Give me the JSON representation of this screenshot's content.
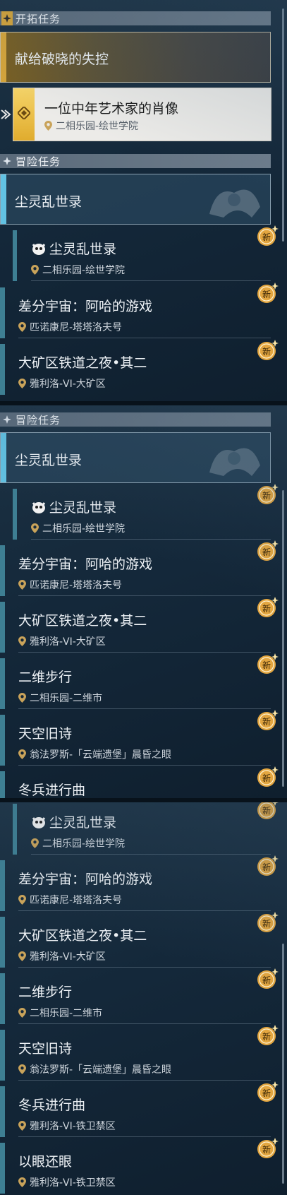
{
  "colors": {
    "gold": "#d6a53a",
    "badge": "#e3a640",
    "cyan": "#62c2e3",
    "header": "#66768a"
  },
  "sections": {
    "trailblaze": "开拓任务",
    "adventure": "冒险任务"
  },
  "new_label": "新",
  "trailblaze_missions": [
    {
      "title": "献给破晓的失控"
    },
    {
      "title": "一位中年艺术家的肖像",
      "location": "二相乐园-绘世学院"
    }
  ],
  "adventure_group": "尘灵乱世录",
  "quests": [
    {
      "title": "尘灵乱世录",
      "location": "二相乐园-绘世学院"
    },
    {
      "title": "差分宇宙：阿哈的游戏",
      "location": "匹诺康尼-塔塔洛夫号"
    },
    {
      "title": "大矿区铁道之夜•其二",
      "location": "雅利洛-VI-大矿区"
    },
    {
      "title": "二维步行",
      "location": "二相乐园-二维市"
    },
    {
      "title": "天空旧诗",
      "location": "翁法罗斯-「云端遗堡」晨昏之眼"
    },
    {
      "title": "冬兵进行曲",
      "location": "雅利洛-VI-铁卫禁区"
    },
    {
      "title": "以眼还眼",
      "location": "雅利洛-VI-铁卫禁区"
    }
  ]
}
